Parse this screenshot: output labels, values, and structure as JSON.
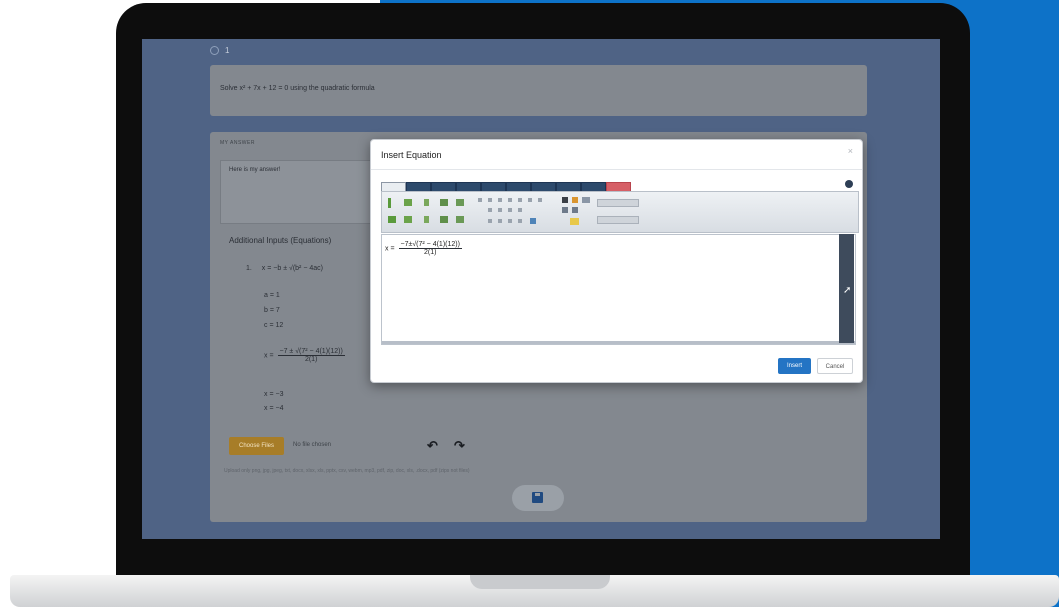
{
  "question": {
    "number": "1",
    "text": "Solve x² + 7x + 12 = 0 using the quadratic formula"
  },
  "answer": {
    "label": "MY ANSWER",
    "text": "Here is my answer!",
    "additional_inputs_title": "Additional Inputs (Equations)",
    "list_number": "1.",
    "eq1": "x = −b ± √(b² − 4ac)",
    "vars": [
      "a = 1",
      "b = 7",
      "c = 12"
    ],
    "eq2_left": "x =",
    "eq2_num": "−7 ± √(7² − 4(1)(12))",
    "eq2_den": "2(1)",
    "solutions": [
      "x = −3",
      "x = −4"
    ]
  },
  "file": {
    "choose_label": "Choose Files",
    "status": "No file chosen",
    "hint": "Upload only png, jpg, jpeg, txt, docx, xlsx, xls, pptx, csv, webm, mp3, pdf, zip, doc, xls, .docx, pdf (zips not files)"
  },
  "modal": {
    "title": "Insert Equation",
    "close": "×",
    "editor_left": "x =",
    "editor_num": "−7±√(7² − 4(1)(12))",
    "editor_den": "2(1)",
    "insert_label": "Insert",
    "cancel_label": "Cancel"
  },
  "colors": {
    "accent": "#2474c4",
    "background_blue": "#0d72c8",
    "choose_button": "#a77d28",
    "tab_red": "#d65f66"
  }
}
